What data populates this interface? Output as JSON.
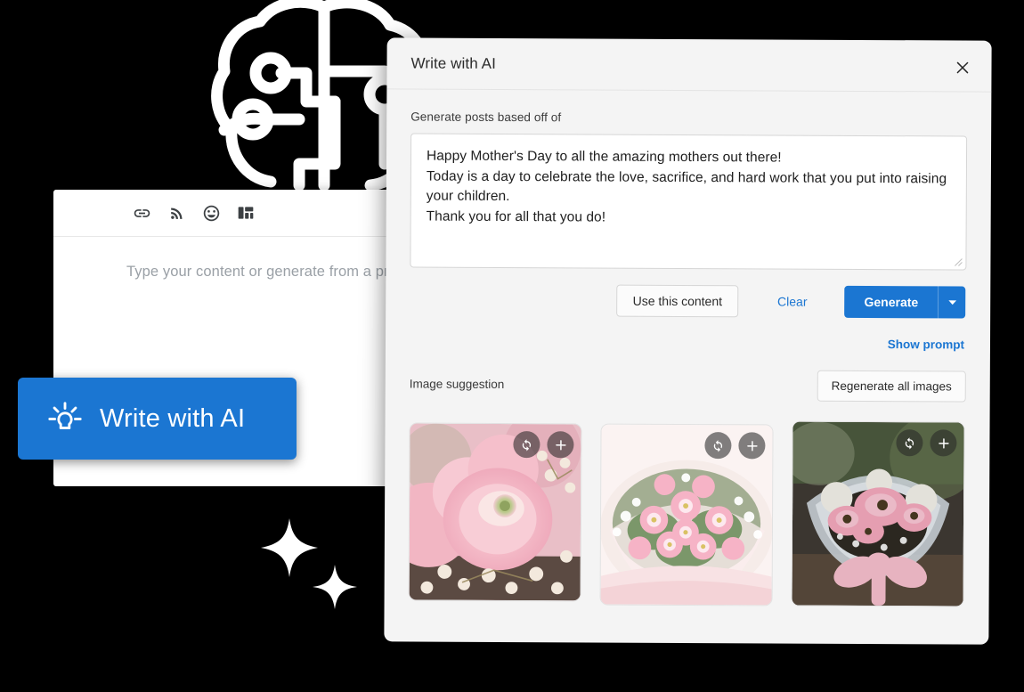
{
  "editor": {
    "toolbar_icons": [
      "link-icon",
      "rss-icon",
      "emoji-icon",
      "layout-icon"
    ],
    "placeholder": "Type your content or generate from a prompt..."
  },
  "write_with_ai_button": {
    "label": "Write with AI",
    "icon": "lightbulb-icon",
    "color": "#1b76d2"
  },
  "modal": {
    "title": "Write with AI",
    "close_icon": "close-icon",
    "prompt": {
      "label": "Generate posts based off of",
      "value": "Happy Mother's Day to all the amazing mothers out there!\nToday is a day to celebrate the love, sacrifice, and hard work that you put into raising your children.\nThank you for all that you do!",
      "placeholder": "Generate posts based off of"
    },
    "actions": {
      "use_content_label": "Use this content",
      "clear_label": "Clear",
      "generate_label": "Generate",
      "generate_caret_icon": "chevron-down-icon",
      "show_prompt_label": "Show prompt"
    },
    "images": {
      "section_label": "Image suggestion",
      "regenerate_all_label": "Regenerate all images",
      "items": [
        {
          "alt": "Pink ranunculus flowers close-up with baby's breath",
          "regenerate_icon": "refresh-icon",
          "add_icon": "plus-icon"
        },
        {
          "alt": "Pale pink and white flower bouquet wrapped in paper",
          "regenerate_icon": "refresh-icon",
          "add_icon": "plus-icon"
        },
        {
          "alt": "Pink gerbera daisy bouquet with ribbon bow",
          "regenerate_icon": "refresh-icon",
          "add_icon": "plus-icon"
        }
      ]
    }
  },
  "decor": {
    "brain_icon": "brain-circuit-icon",
    "sparkle_icons": [
      "sparkle-icon",
      "sparkle-icon"
    ],
    "background_color": "#000000"
  }
}
